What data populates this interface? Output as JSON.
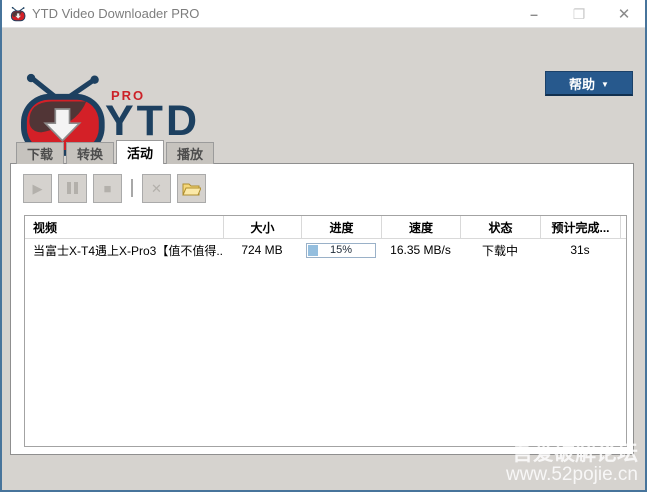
{
  "window": {
    "title": "YTD Video Downloader PRO",
    "minimize_glyph": "–",
    "maximize_glyph": "❐",
    "close_glyph": "✕"
  },
  "branding": {
    "pro_badge": "PRO",
    "app_name": "YTD"
  },
  "help_button": {
    "label": "帮助",
    "arrow_glyph": "▼"
  },
  "tabs": [
    {
      "label": "下载"
    },
    {
      "label": "转换"
    },
    {
      "label": "活动"
    },
    {
      "label": "播放"
    }
  ],
  "toolbar": {
    "play_glyph": "▶",
    "stop_glyph": "■",
    "delete_glyph": "✕"
  },
  "table": {
    "columns": [
      {
        "label": "视频"
      },
      {
        "label": "大小"
      },
      {
        "label": "进度"
      },
      {
        "label": "速度"
      },
      {
        "label": "状态"
      },
      {
        "label": "预计完成..."
      }
    ],
    "rows": [
      {
        "video": "当富士X-T4遇上X-Pro3【值不值得...",
        "size": "724 MB",
        "progress_percent": 15,
        "progress_label": "15%",
        "speed": "16.35 MB/s",
        "status": "下载中",
        "eta": "31s"
      }
    ]
  },
  "watermark": {
    "line1": "吾爱破解论坛",
    "line2": "www.52pojie.cn"
  },
  "colors": {
    "window_border": "#47749b",
    "accent_blue": "#27598d",
    "logo_navy": "#1d4060",
    "logo_red": "#cc2128",
    "progress_fill": "#94bede",
    "progress_border": "#9ab1c8",
    "body_background": "#d6d3cf"
  }
}
